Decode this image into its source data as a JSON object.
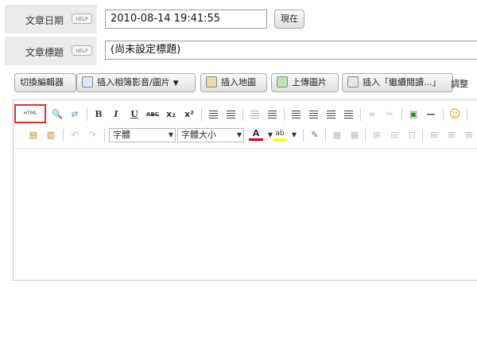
{
  "date_row": {
    "label": "文章日期",
    "help": "HELP",
    "value": "2010-08-14 19:41:55",
    "now_button": "現在"
  },
  "title_row": {
    "label": "文章標題",
    "help": "HELP",
    "value": "(尚未設定標題)"
  },
  "toolbar": {
    "switch_editor": "切換編輯器",
    "insert_album_media": "插入相簿影音/圖片",
    "insert_map": "插入地圖",
    "upload_image": "上傳圖片",
    "insert_continue": "插入「繼續閱讀...」",
    "adjust": "調整"
  },
  "editor": {
    "html_label": "HTML",
    "font_select": "字體",
    "size_select": "字體大小",
    "text_color_glyph": "A",
    "highlight_glyph": "ab",
    "row1_icons": [
      "find-icon",
      "replace-icon",
      "bold-icon",
      "italic-icon",
      "underline-icon",
      "strikethrough-icon",
      "subscript-icon",
      "superscript-icon",
      "ordered-list-icon",
      "unordered-list-icon",
      "outdent-icon",
      "indent-icon",
      "align-left-icon",
      "align-center-icon",
      "align-right-icon",
      "justify-icon",
      "link-icon",
      "unlink-icon",
      "image-icon",
      "horizontal-rule-icon",
      "emoticon-icon"
    ],
    "row2_icons": [
      "paste-text-icon",
      "paste-word-icon",
      "undo-icon",
      "redo-icon",
      "font-color-icon",
      "highlight-icon",
      "edit-icon",
      "table-icon",
      "table-props-icon",
      "insert-column-icon",
      "delete-column-icon",
      "merge-cells-icon",
      "split-cells-icon"
    ],
    "colors": {
      "highlight_border": "#e53030",
      "text_color_bar": "#d40000",
      "highlight_bar": "#ffff00"
    }
  }
}
